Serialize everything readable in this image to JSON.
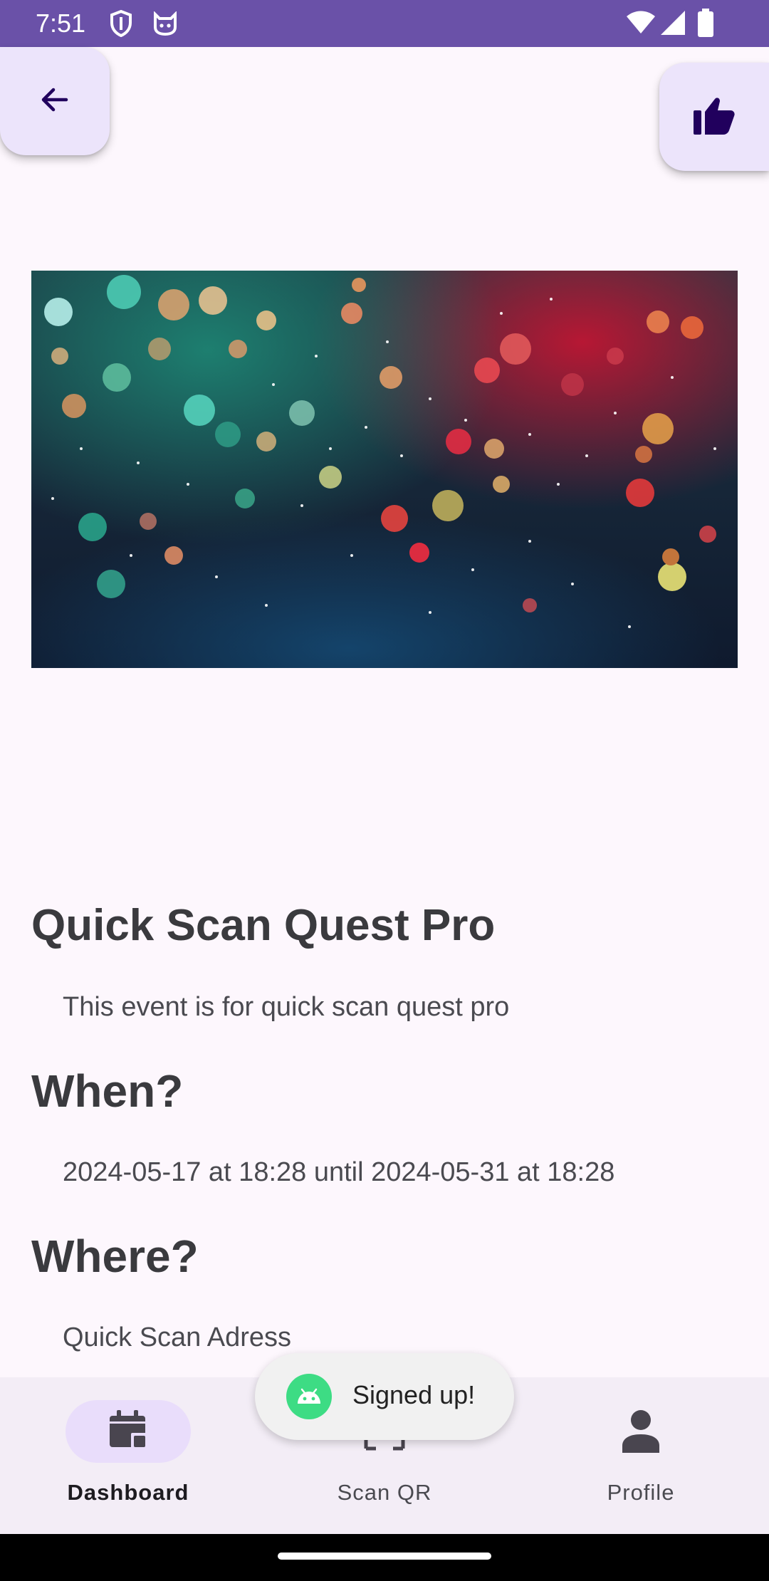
{
  "status_bar": {
    "time": "7:51",
    "icons": [
      "shield-icon",
      "cat-face-icon",
      "wifi-icon",
      "signal-icon",
      "battery-icon"
    ]
  },
  "top_actions": {
    "back_icon": "arrow-back-icon",
    "like_icon": "thumb-up-icon"
  },
  "event": {
    "title": "Quick Scan Quest Pro",
    "description": "This event is for quick scan quest pro",
    "when_heading": "When?",
    "when_value": "2024-05-17 at 18:28 until 2024-05-31 at 18:28",
    "where_heading": "Where?",
    "where_value": "Quick Scan Adress"
  },
  "bottom_nav": {
    "items": [
      {
        "label": "Dashboard",
        "icon": "calendar-icon",
        "active": true
      },
      {
        "label": "Scan QR",
        "icon": "qr-scan-icon",
        "active": false
      },
      {
        "label": "Profile",
        "icon": "person-icon",
        "active": false
      }
    ]
  },
  "toast": {
    "text": "Signed up!",
    "icon": "android-icon"
  },
  "colors": {
    "status_bar": "#6a51a8",
    "background": "#fdf7fd",
    "fab_bg": "#ece4fb",
    "icon_dark": "#21005d",
    "nav_bg": "#f3edf6",
    "nav_pill": "#e9ddfb",
    "toast_icon": "#3ddc84"
  }
}
